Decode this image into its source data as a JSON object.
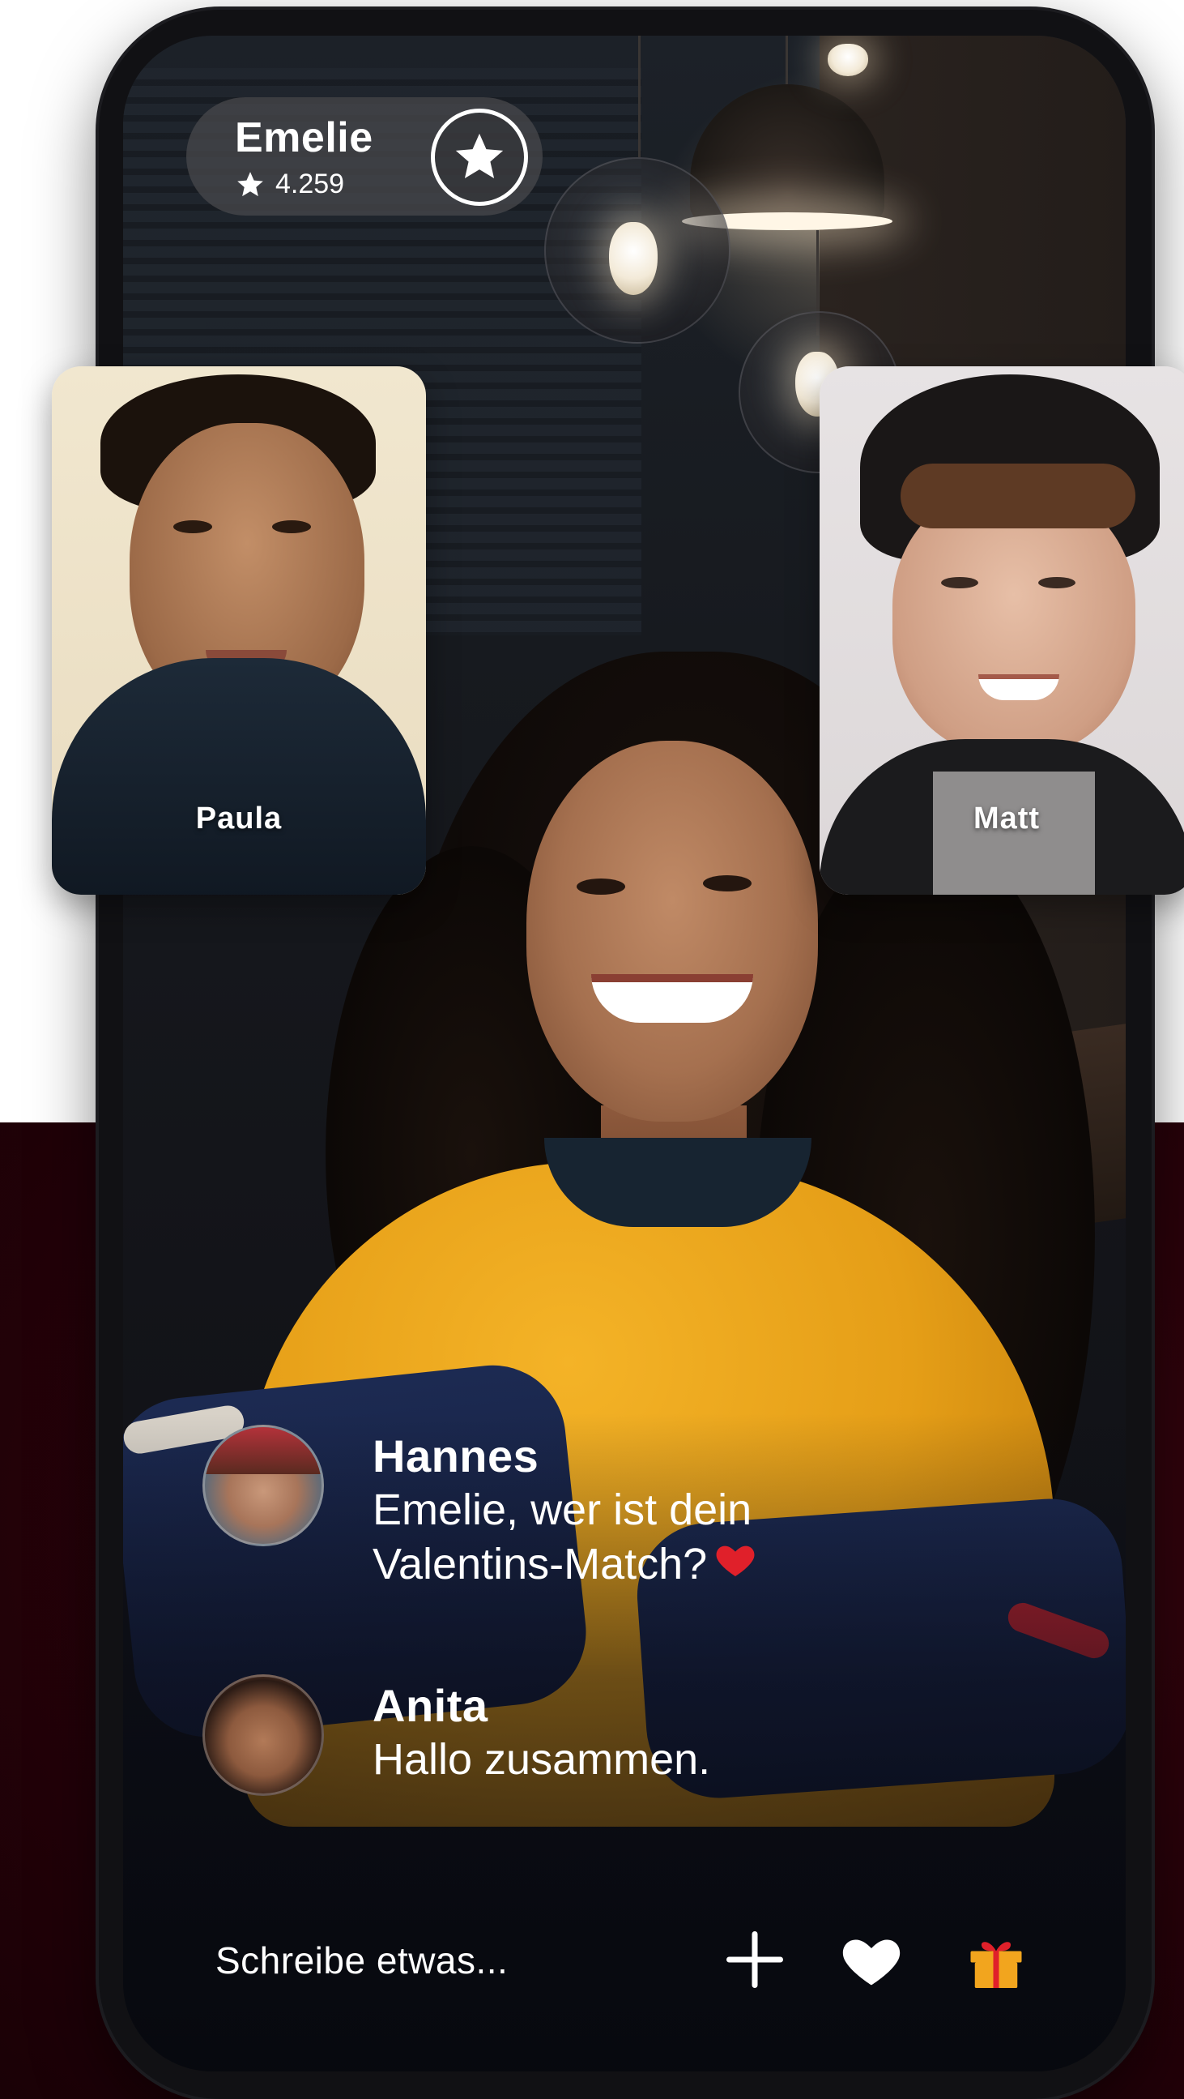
{
  "host": {
    "name": "Emelie",
    "rating": "4.259"
  },
  "guests": [
    {
      "name": "Paula"
    },
    {
      "name": "Matt"
    }
  ],
  "chat": [
    {
      "author": "Hannes",
      "line1": "Emelie, wer ist dein",
      "line2": "Valentins-Match?"
    },
    {
      "author": "Anita",
      "line1": "Hallo zusammen.",
      "line2": ""
    }
  ],
  "composer": {
    "placeholder": "Schreibe etwas..."
  },
  "icons": {
    "follow": "star-icon",
    "add": "plus-icon",
    "like": "heart-icon",
    "gift": "gift-icon"
  },
  "colors": {
    "maroon": "#2a020a",
    "gift": "#f2a51e",
    "heart": "#e0202a"
  }
}
